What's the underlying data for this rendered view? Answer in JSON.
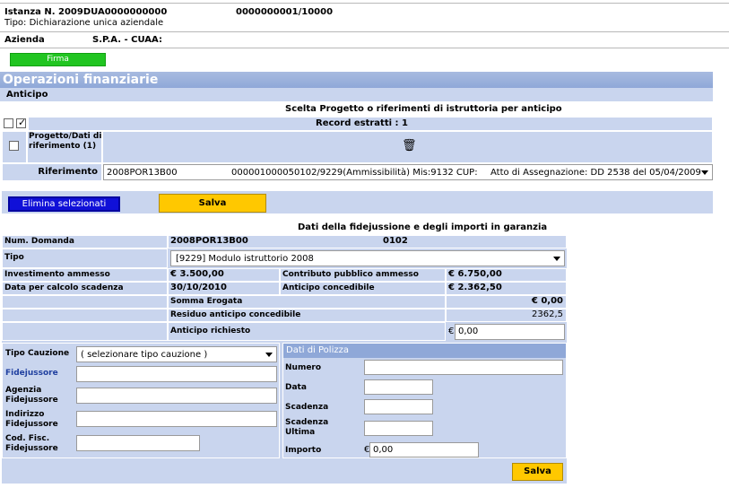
{
  "header": {
    "istanza_label": "Istanza N. 2009DUA0000000000",
    "istanza_num": "0000000001/10000",
    "tipo": "Tipo: Dichiarazione unica aziendale",
    "azienda_label": "Azienda",
    "azienda_value": "S.P.A. - CUAA:"
  },
  "firma_button": "Firma",
  "section_title": "Operazioni finanziarie",
  "subsection": "Anticipo",
  "scelta_title": "Scelta Progetto o riferimenti di istruttoria per anticipo",
  "record_estratti": "Record estratti : 1",
  "progetto_header": "Progetto/Dati di riferimento (1)",
  "trash_icon": "trash-icon",
  "riferimento_label": "Riferimento",
  "riferimento_select": {
    "code": "2008POR13B00",
    "detail": "000001000050102/9229(Ammissibilità) Mis:9132 CUP:",
    "atto": "Atto di Assegnazione: DD 2538 del 05/04/2009"
  },
  "buttons": {
    "elimina": "Elimina selezionati",
    "salva": "Salva"
  },
  "fideiussione_title": "Dati della fidejussione e degli importi in garanzia",
  "details": {
    "num_domanda_label": "Num. Domanda",
    "num_domanda_value": "2008POR13B00",
    "num_domanda_extra": "0102",
    "tipo_label": "Tipo",
    "tipo_value": "[9229] Modulo istruttorio 2008",
    "investimento_label": "Investimento ammesso",
    "investimento_value": "€   3.500,00",
    "contributo_label": "Contributo pubblico ammesso",
    "contributo_value": "€ 6.750,00",
    "data_scadenza_label": "Data per calcolo scadenza",
    "data_scadenza_value": "30/10/2010",
    "anticipo_conc_label": "Anticipo concedibile",
    "anticipo_conc_value": "€ 2.362,50",
    "somma_label": "Somma Erogata",
    "somma_value": "€ 0,00",
    "residuo_label": "Residuo anticipo concedibile",
    "residuo_value": "2362,5",
    "anticipo_rich_label": "Anticipo richiesto",
    "anticipo_rich_currency": "€",
    "anticipo_rich_value": "0,00"
  },
  "cauzione": {
    "tipo_label": "Tipo Cauzione",
    "tipo_value": "( selezionare tipo cauzione )",
    "fidejussore_label": "Fidejussore",
    "agenzia_label": "Agenzia Fidejussore",
    "indirizzo_label": "Indirizzo Fidejussore",
    "codfisc_label": "Cod. Fisc. Fidejussore"
  },
  "polizza": {
    "title": "Dati di Polizza",
    "numero_label": "Numero",
    "data_label": "Data",
    "scadenza_label": "Scadenza",
    "scadenza_ultima_label": "Scadenza Ultima",
    "importo_label": "Importo",
    "importo_currency": "€",
    "importo_value": "0,00"
  }
}
